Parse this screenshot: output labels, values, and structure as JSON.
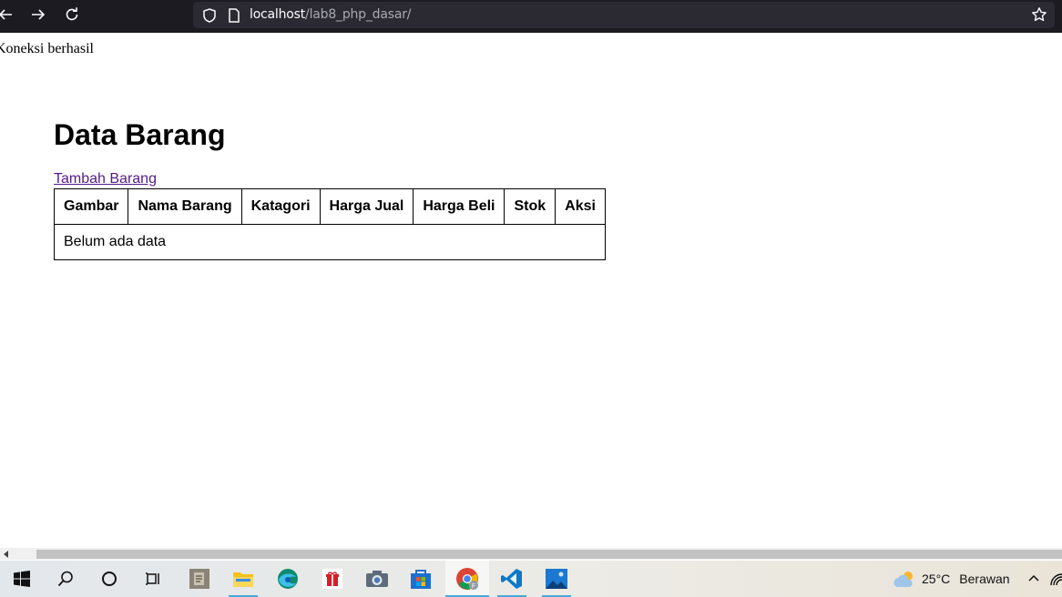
{
  "browser": {
    "url_host": "localhost",
    "url_path": "/lab8_php_dasar/"
  },
  "page": {
    "connection_status": "Koneksi berhasil",
    "title": "Data Barang",
    "add_link": "Tambah Barang",
    "table": {
      "headers": [
        "Gambar",
        "Nama Barang",
        "Katagori",
        "Harga Jual",
        "Harga Beli",
        "Stok",
        "Aksi"
      ],
      "empty_message": "Belum ada data"
    }
  },
  "taskbar": {
    "weather_temp": "25°C",
    "weather_condition": "Berawan",
    "apps": [
      "start-icon",
      "search-icon",
      "cortana-icon",
      "task-view-icon",
      "app-icon",
      "file-explorer-icon",
      "edge-icon",
      "gift-app-icon",
      "camera-icon",
      "store-icon",
      "chrome-icon",
      "vscode-icon",
      "photos-icon"
    ]
  },
  "colors": {
    "toolbar_bg": "#1c1b22",
    "urlbar_bg": "#2b2a33",
    "visited_link": "#551a8b",
    "taskbar_accent": "#4aa8d8"
  }
}
